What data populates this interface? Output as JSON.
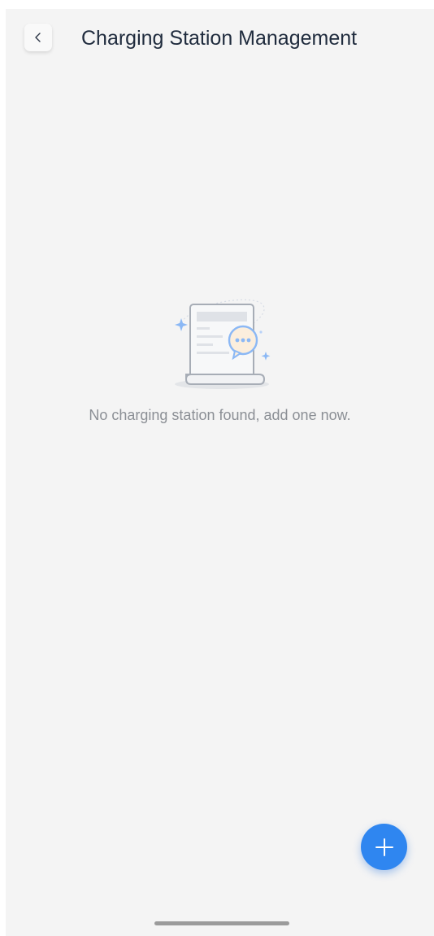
{
  "header": {
    "back_icon": "chevron-left-icon",
    "title": "Charging Station Management"
  },
  "empty_state": {
    "illustration": "empty-document-chat-icon",
    "message": "No charging station found, add one now."
  },
  "fab": {
    "icon": "plus-icon"
  },
  "colors": {
    "background": "#f4f4f4",
    "title": "#1f2b3d",
    "message": "#8b8f95",
    "accent": "#2f86f0"
  }
}
